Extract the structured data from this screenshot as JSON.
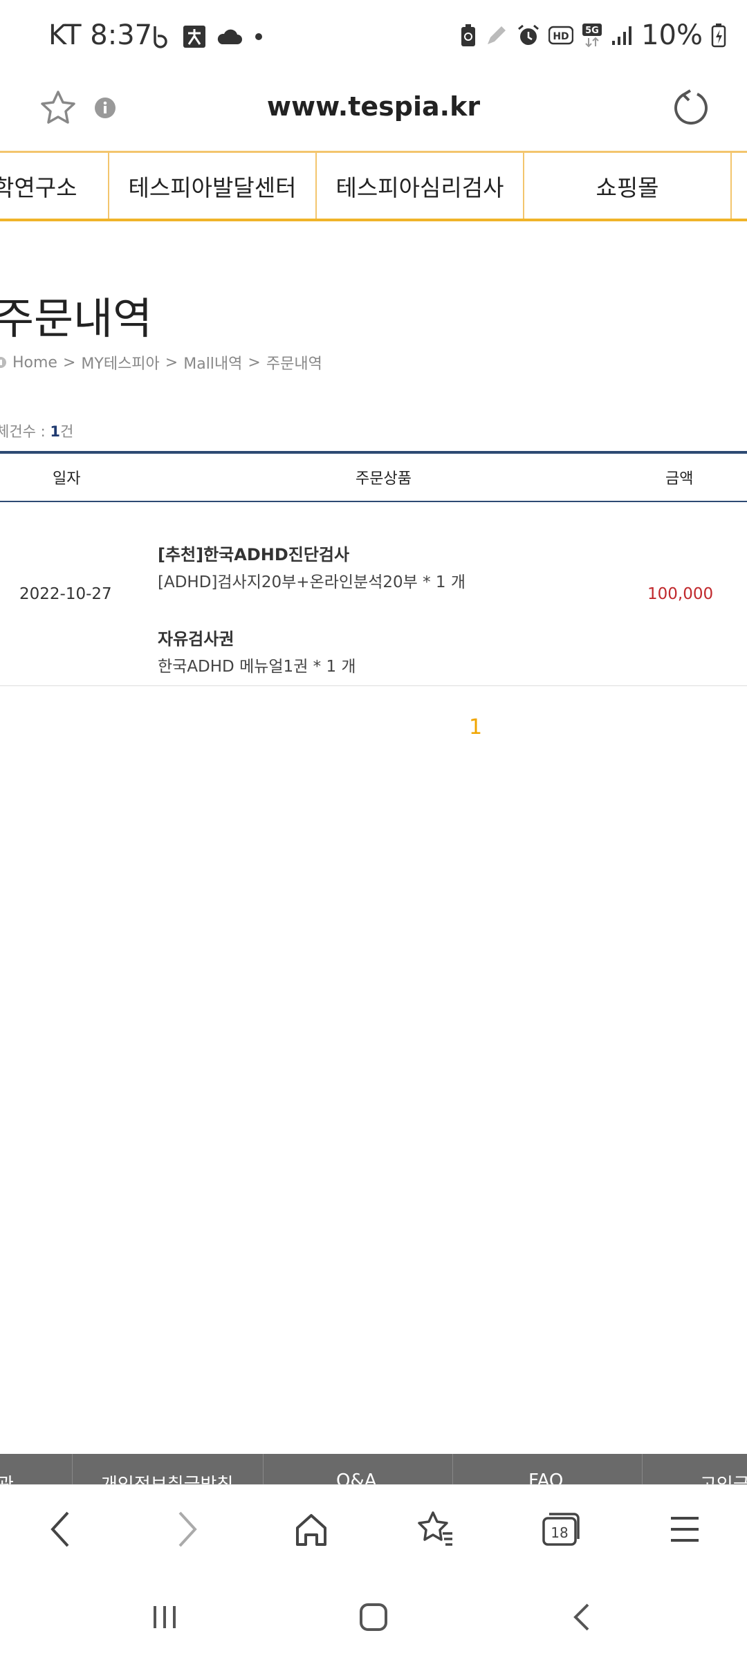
{
  "status_bar": {
    "carrier_time": "KT 8:37",
    "battery": "10%",
    "icons": [
      "b-app-icon",
      "dae-app-icon",
      "cloud-icon",
      "dot-icon",
      "battery-saver-icon",
      "pen-icon",
      "alarm-icon",
      "hd-icon",
      "5g-icon",
      "signal-icon",
      "battery-icon"
    ]
  },
  "url_bar": {
    "url": "www.tespia.kr",
    "icons": [
      "star-icon",
      "info-icon",
      "reload-icon"
    ]
  },
  "nav": {
    "items": [
      "학연구소",
      "테스피아발달센터",
      "테스피아심리검사",
      "쇼핑몰"
    ]
  },
  "page": {
    "title": "주문내역",
    "breadcrumb": [
      "Home",
      "MY테스피아",
      "Mall내역",
      "주문내역"
    ],
    "total_label": "체건수 : ",
    "total_count": "1",
    "total_unit": "건"
  },
  "table": {
    "headers": [
      "일자",
      "주문상품",
      "금액"
    ],
    "rows": [
      {
        "date": "2022-10-27",
        "items": [
          {
            "title": "[추천]한국ADHD진단검사",
            "option": "[ADHD]검사지20부+온라인분석20부 * 1 개"
          },
          {
            "title": "자유검사권",
            "option": "한국ADHD 메뉴얼1권 * 1 개"
          }
        ],
        "amount": "100,000"
      }
    ]
  },
  "pagination": {
    "current": "1"
  },
  "footer": {
    "items": [
      "관",
      "개인정보취급방침",
      "Q&A",
      "FAQ",
      "고인금"
    ]
  },
  "colors": {
    "accent_orange": "#f0b429",
    "table_border": "#2d4a73",
    "price_red": "#c0282c",
    "page_number": "#f0a500"
  }
}
